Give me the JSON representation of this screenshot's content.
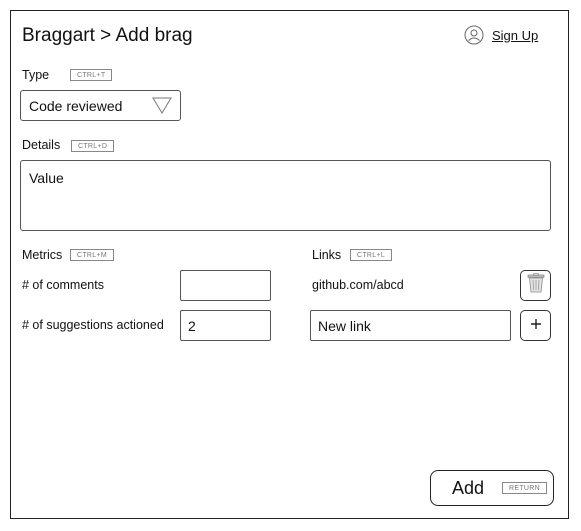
{
  "header": {
    "title": "Braggart > Add brag",
    "signup_label": "Sign Up"
  },
  "type_section": {
    "label": "Type",
    "shortcut": "CTRL+T",
    "selected_value": "Code reviewed"
  },
  "details_section": {
    "label": "Details",
    "shortcut": "CTRL+D",
    "value": "Value"
  },
  "metrics_section": {
    "label": "Metrics",
    "shortcut": "CTRL+M",
    "items": [
      {
        "label": "# of comments",
        "value": ""
      },
      {
        "label": "# of suggestions actioned",
        "value": "2"
      }
    ]
  },
  "links_section": {
    "label": "Links",
    "shortcut": "CTRL+L",
    "existing_link": "github.com/abcd",
    "new_link_value": "New link"
  },
  "footer": {
    "add_label": "Add",
    "add_shortcut": "RETURN"
  }
}
